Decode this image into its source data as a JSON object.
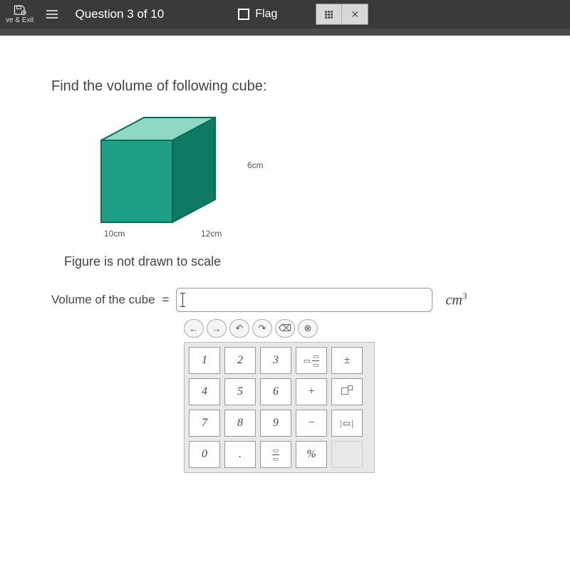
{
  "topbar": {
    "save_exit_label": "ve & Exit",
    "question_label": "Question 3 of 10",
    "flag_label": "Flag"
  },
  "question": {
    "prompt": "Find the volume of following cube:",
    "dim_height": "6cm",
    "dim_width": "10cm",
    "dim_depth": "12cm",
    "scale_note": "Figure is not drawn to scale",
    "answer_label": "Volume of the cube",
    "equals": "=",
    "unit_base": "cm",
    "unit_exp": "3"
  },
  "keypad": {
    "nav": [
      "←",
      "→",
      "↶",
      "↷",
      "⌫",
      "⊗"
    ],
    "rows": [
      [
        "1",
        "2",
        "3",
        "mixed",
        "±"
      ],
      [
        "4",
        "5",
        "6",
        "+",
        "exp"
      ],
      [
        "7",
        "8",
        "9",
        "−",
        "abs"
      ],
      [
        "0",
        ".",
        "frac",
        "%",
        ""
      ]
    ]
  }
}
